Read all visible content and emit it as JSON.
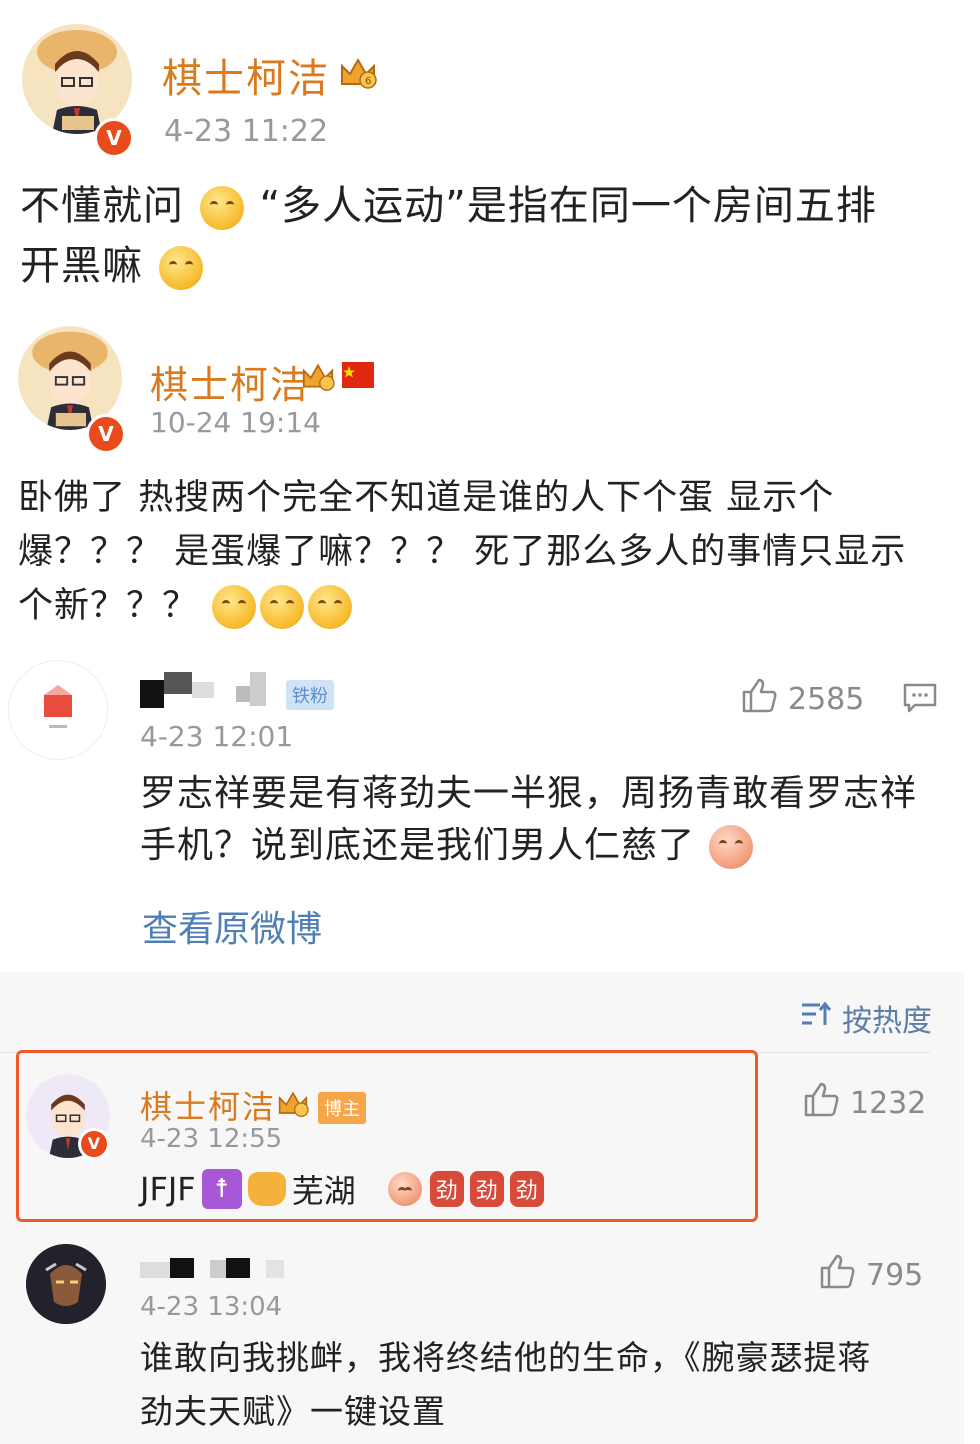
{
  "post1": {
    "username": "棋士柯洁",
    "time": "4-23 11:22",
    "text_line1": "不懂就问",
    "text_line1b": "“多人运动”是指在同一个房间五排",
    "text_line2": "开黑嘛"
  },
  "post2": {
    "username": "棋士柯洁",
    "time": "10-24 19:14",
    "line1": "卧佛了 热搜两个完全不知道是谁的人下个蛋 显示个",
    "line2": "爆？？？ 是蛋爆了嘛？？？ 死了那么多人的事情只显示",
    "line3": "个新？？？"
  },
  "comment_main": {
    "badge": "铁粉",
    "likes": "2585",
    "time": "4-23 12:01",
    "line1": "罗志祥要是有蒋劲夫一半狠，周扬青敢看罗志祥",
    "line2": "手机？说到底还是我们男人仁慈了",
    "view_original": "查看原微博"
  },
  "sort": {
    "label": "按热度"
  },
  "reply1": {
    "username": "棋士柯洁",
    "badge": "博主",
    "time": "4-23 12:55",
    "text_a": "JFJF",
    "text_b": "芜湖",
    "likes": "1232",
    "hl_char": "劲"
  },
  "reply2": {
    "time": "4-23 13:04",
    "likes": "795",
    "line1": "谁敢向我挑衅，我将终结他的生命，《腕豪瑟提蒋",
    "line2": "劲夫天赋》一键设置"
  },
  "colors": {
    "username": "#d97a1e",
    "time": "#999999",
    "highlight_box": "#ef5a2a",
    "link": "#4f7fb5"
  }
}
